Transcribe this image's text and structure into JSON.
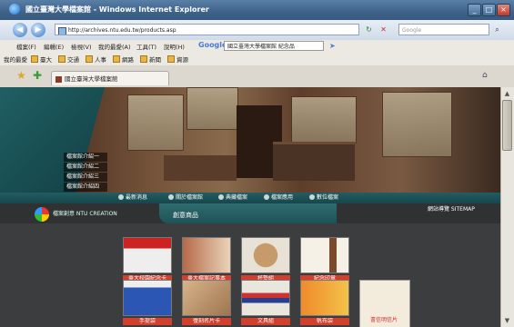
{
  "window": {
    "title": "國立臺灣大學檔案館 - Windows Internet Explorer",
    "controls": [
      "_",
      "□",
      "×"
    ]
  },
  "toolbar": {
    "back_icon": "back-arrow-icon",
    "forward_icon": "forward-arrow-icon",
    "address": "http://archives.ntu.edu.tw/products.asp",
    "search_placeholder": "Google"
  },
  "menubar": {
    "items": [
      "檔案(F)",
      "編輯(E)",
      "檢視(V)",
      "我的最愛(A)",
      "工具(T)",
      "說明(H)"
    ],
    "google_label": "Google",
    "google_query": "國立臺灣大學檔案館 紀念品"
  },
  "favbar": {
    "items": [
      "我的最愛",
      "臺大",
      "交通",
      "人事",
      "網路",
      "新聞",
      "資源"
    ]
  },
  "tabs": {
    "active": "國立臺灣大學檔案館"
  },
  "site": {
    "side_menu": [
      "檔案館介紹一",
      "檔案館介紹二",
      "檔案館介紹三",
      "檔案館介紹四"
    ],
    "nav": [
      "最新消息",
      "關於檔案館",
      "典藏檔案",
      "檔案應用",
      "數位檔案"
    ],
    "logo_text": "檔案創意 NTU CREATION",
    "section_title": "創意商品",
    "sitemap": "網站導覽 SITEMAP",
    "products_row1": [
      "臺大校園紀念卡",
      "臺大檔案記事本",
      "杯墊組",
      "紀念印章"
    ],
    "products_row2": [
      "手提袋",
      "復刻名片卡",
      "文具組",
      "帆布袋"
    ],
    "extra_label": "書信明信片"
  }
}
